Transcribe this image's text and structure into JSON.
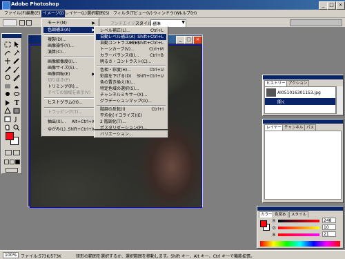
{
  "app": {
    "title": "Adobe Photoshop",
    "window_buttons": [
      "_",
      "□",
      "×"
    ]
  },
  "menubar": [
    "ファイル(F)",
    "編集(E)",
    "イメージ(I)",
    "レイヤー(L)",
    "選択範囲(S)",
    "フィルタ(T)",
    "ビュー(V)",
    "ウィンドウ(W)",
    "ヘルプ(H)"
  ],
  "options": {
    "antialias_label": "アンチエイリアス",
    "style_label": "スタイル",
    "style_value": "標準"
  },
  "image_menu": [
    {
      "label": "モード(M)",
      "arrow": true
    },
    {
      "label": "色調補正(A)",
      "arrow": true,
      "active": true
    },
    {
      "label": "複製(D)..."
    },
    {
      "label": "画像操作(Y)..."
    },
    {
      "label": "演算(C)..."
    },
    {
      "label": "画像解像度(I)..."
    },
    {
      "label": "画像サイズ(S)..."
    },
    {
      "label": "画像回転(E)",
      "arrow": true
    },
    {
      "label": "切り抜き(P)",
      "disabled": true
    },
    {
      "label": "トリミング(R)..."
    },
    {
      "label": "すべての領域を表示(V)",
      "disabled": true
    },
    {
      "label": "ヒストグラム(H)..."
    },
    {
      "label": "トラッピング(T)...",
      "disabled": true
    },
    {
      "label": "抽出(X)...",
      "key": "Alt+Ctrl+X"
    },
    {
      "label": "ゆがみ(L)...",
      "key": "Shift+Ctrl+X"
    }
  ],
  "adjust_submenu": [
    {
      "label": "レベル補正(L)...",
      "key": "Ctrl+L"
    },
    {
      "label": "自動レベル補正(A)",
      "key": "Shift+Ctrl+L",
      "active": true
    },
    {
      "label": "自動コントラスト(U)",
      "key": "Alt+Shift+Ctrl+L"
    },
    {
      "label": "トーンカーブ(V)...",
      "key": "Ctrl+M"
    },
    {
      "label": "カラーバランス(B)...",
      "key": "Ctrl+B"
    },
    {
      "label": "明るさ・コントラスト(C)..."
    },
    {
      "label": "色相・彩度(H)...",
      "key": "Ctrl+U"
    },
    {
      "label": "彩度を下げる(D)",
      "key": "Shift+Ctrl+U"
    },
    {
      "label": "色の置き換え(R)..."
    },
    {
      "label": "特定色域の選択(S)..."
    },
    {
      "label": "チャンネルミキサー(X)..."
    },
    {
      "label": "グラデーションマップ(G)..."
    },
    {
      "label": "階調の反転(I)",
      "key": "Ctrl+I"
    },
    {
      "label": "平均化(イコライズ)(E)"
    },
    {
      "label": "2 階調化(T)..."
    },
    {
      "label": "ポスタリゼーション(P)..."
    },
    {
      "label": "バリエーション..."
    }
  ],
  "history_panel": {
    "tabs": [
      "ヒストリー",
      "アクション"
    ],
    "filename": "AI0510163011S3.jpg",
    "state": "開く"
  },
  "layers_panel": {
    "tabs": [
      "レイヤー",
      "チャンネル",
      "パス"
    ]
  },
  "color_panel": {
    "tabs": [
      "カラー",
      "色見本",
      "スタイル"
    ],
    "channels": [
      {
        "label": "R",
        "value": "248",
        "color": "#ff0000"
      },
      {
        "label": "G",
        "value": "10",
        "color": "#00a000"
      },
      {
        "label": "B",
        "value": "21",
        "color": "#0000ff"
      }
    ],
    "foreground": "#f80a15"
  },
  "status": {
    "zoom": "100%",
    "file": "ファイル:573K/573K",
    "hint": "矩形の範囲を選択するか、選択範囲を移動します。Shift キー、Alt キー、Ctrl キーで機能拡張。"
  }
}
